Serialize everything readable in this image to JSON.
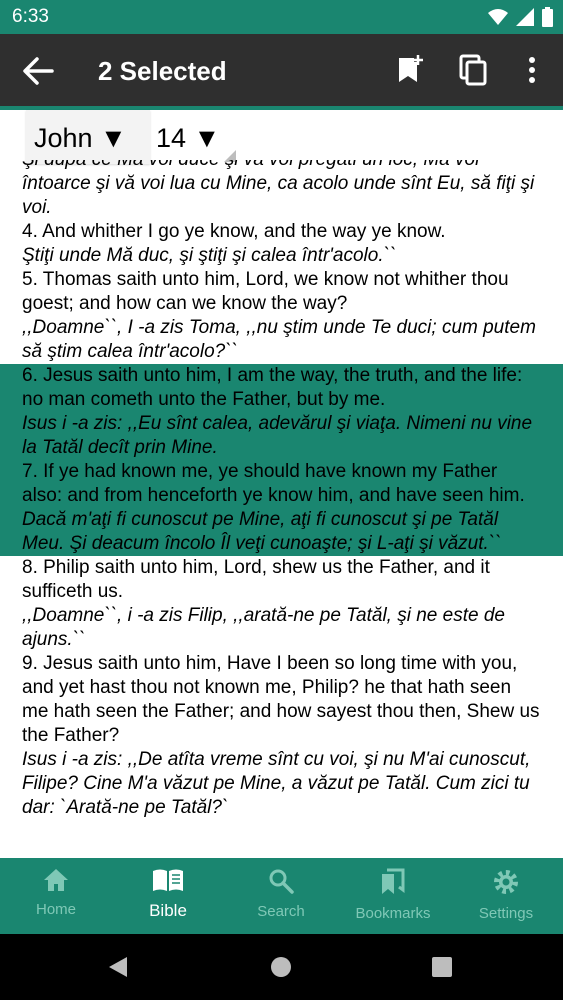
{
  "status": {
    "time": "6:33",
    "icons": [
      "wifi-icon",
      "signal-icon",
      "battery-icon"
    ]
  },
  "appbar": {
    "title": "2 Selected"
  },
  "selector": {
    "book": "John ▼",
    "chapter": "14 ▼"
  },
  "verses": [
    {
      "en": "",
      "ro": "Şi după ce Mă voi duce şi vă voi pregăti un loc, Mă voi întoarce şi vă voi lua cu Mine, ca acolo unde sînt Eu, să fiţi şi voi.",
      "selected": false
    },
    {
      "en": "4. And whither I go ye know, and the way ye know.",
      "ro": "Ştiţi unde Mă duc, şi ştiţi şi calea într'acolo.``",
      "selected": false
    },
    {
      "en": "5. Thomas saith unto him, Lord, we know not whither thou goest; and how can we know the way?",
      "ro": ",,Doamne``, I -a zis Toma, ,,nu ştim unde Te duci; cum putem să ştim calea într'acolo?``",
      "selected": false
    },
    {
      "en": "6. Jesus saith unto him, I am the way, the truth, and the life: no man cometh unto the Father, but by me.",
      "ro": "Isus i -a zis: ,,Eu sînt calea, adevărul şi viaţa. Nimeni nu vine la Tatăl decît prin Mine.",
      "selected": true
    },
    {
      "en": "7. If ye had known me, ye should have known my Father also: and from henceforth ye know him, and have seen him.",
      "ro": "Dacă m'aţi fi cunoscut pe Mine, aţi fi cunoscut şi pe Tatăl Meu. Şi deacum încolo Îl veţi cunoaşte; şi L-aţi şi văzut.``",
      "selected": true
    },
    {
      "en": "8. Philip saith unto him, Lord, shew us the Father, and it sufficeth us.",
      "ro": ",,Doamne``, i -a zis Filip, ,,arată-ne pe Tatăl, şi ne este de ajuns.``",
      "selected": false
    },
    {
      "en": "9. Jesus saith unto him, Have I been so long time with you, and yet hast thou not known me, Philip? he that hath seen me hath seen the Father; and how sayest thou then, Shew us the Father?",
      "ro": "Isus i -a zis: ,,De atîta vreme sînt cu voi, şi nu M'ai cunoscut, Filipe? Cine M'a văzut pe Mine, a văzut pe Tatăl. Cum zici tu dar: `Arată-ne pe Tatăl?`",
      "selected": false
    }
  ],
  "nav": [
    {
      "label": "Home",
      "icon": "home-icon",
      "active": false
    },
    {
      "label": "Bible",
      "icon": "book-icon",
      "active": true
    },
    {
      "label": "Search",
      "icon": "search-icon",
      "active": false
    },
    {
      "label": "Bookmarks",
      "icon": "bookmarks-icon",
      "active": false
    },
    {
      "label": "Settings",
      "icon": "settings-icon",
      "active": false
    }
  ],
  "colors": {
    "accent": "#1a8670",
    "appbar": "#2f2f2f",
    "nav_inactive": "#7fc8b6"
  }
}
